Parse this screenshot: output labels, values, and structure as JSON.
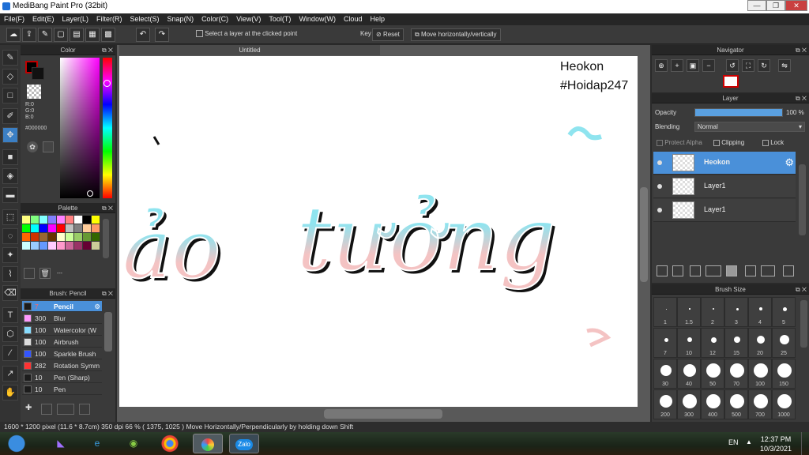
{
  "window": {
    "title": "MediBang Paint Pro (32bit)",
    "minimize": "—",
    "restore": "❐",
    "close": "✕"
  },
  "menu": [
    "File(F)",
    "Edit(E)",
    "Layer(L)",
    "Filter(R)",
    "Select(S)",
    "Snap(N)",
    "Color(C)",
    "View(V)",
    "Tool(T)",
    "Window(W)",
    "Cloud",
    "Help"
  ],
  "toolbar": {
    "select_layer_label": "Select a layer at the clicked point",
    "key_label": "Key",
    "reset_label": "Reset",
    "move_label": "Move horizontally/vertically"
  },
  "color_panel": {
    "title": "Color",
    "r": "R:0",
    "g": "G:0",
    "b": "B:0",
    "hex": "#000000",
    "fg": "#000000",
    "accent": "#c00000"
  },
  "palette_panel": {
    "title": "Palette",
    "colors": [
      "#ffff80",
      "#80ff80",
      "#80ffff",
      "#8080ff",
      "#ff80ff",
      "#ff8080",
      "#ffffff",
      "#000000",
      "#ffff00",
      "#00ff00",
      "#00ffff",
      "#0000ff",
      "#ff00ff",
      "#ff0000",
      "#c0c0c0",
      "#808080",
      "#ffcc99",
      "#ff9966",
      "#ff6600",
      "#cc3300",
      "#996633",
      "#663300",
      "#ffffcc",
      "#ccff99",
      "#99cc66",
      "#669933",
      "#336600",
      "#ccffff",
      "#99ccff",
      "#6699ff",
      "#ffccff",
      "#ff99cc",
      "#cc6699",
      "#993366",
      "#660033",
      "#cccc99"
    ],
    "dash": "---"
  },
  "brush_panel": {
    "title": "Brush: Pencil",
    "items": [
      {
        "size": "7",
        "name": "Pencil",
        "color": "#1c1c1c"
      },
      {
        "size": "300",
        "name": "Blur",
        "color": "#ff99ff"
      },
      {
        "size": "100",
        "name": "Watercolor (W",
        "color": "#88ddff"
      },
      {
        "size": "100",
        "name": "Airbrush",
        "color": "#dddddd"
      },
      {
        "size": "100",
        "name": "Sparkle Brush",
        "color": "#3355ff"
      },
      {
        "size": "282",
        "name": "Rotation Symm",
        "color": "#ff3333"
      },
      {
        "size": "10",
        "name": "Pen (Sharp)",
        "color": "#1c1c1c"
      },
      {
        "size": "10",
        "name": "Pen",
        "color": "#1c1c1c"
      }
    ]
  },
  "canvas": {
    "tab": "Untitled",
    "watermark_line1": "Heokon",
    "watermark_line2": "#Hoidap247",
    "art_text_left": "ảo",
    "art_text_right": "tưởng"
  },
  "navigator": {
    "title": "Navigator"
  },
  "layer_panel": {
    "title": "Layer",
    "opacity_label": "Opacity",
    "opacity_value": "100 %",
    "opacity_fraction": 1.0,
    "blending_label": "Blending",
    "blending_value": "Normal",
    "protect_alpha": "Protect Alpha",
    "clipping": "Clipping",
    "lock": "Lock",
    "layers": [
      {
        "name": "Heokon",
        "selected": true
      },
      {
        "name": "Layer1",
        "selected": false
      },
      {
        "name": "Layer1",
        "selected": false
      }
    ]
  },
  "brush_size_panel": {
    "title": "Brush Size",
    "sizes": [
      "1",
      "1.5",
      "2",
      "3",
      "4",
      "5",
      "7",
      "10",
      "12",
      "15",
      "20",
      "25",
      "30",
      "40",
      "50",
      "70",
      "100",
      "150",
      "200",
      "300",
      "400",
      "500",
      "700",
      "1000"
    ]
  },
  "status": "1600 * 1200 pixel   (11.6 * 8.7cm)   350 dpi   66 %   ( 1375, 1025 )   Move Horizontally/Perpendicularly by holding down Shift",
  "taskbar": {
    "lang": "EN",
    "time": "12:37 PM",
    "date": "10/3/2021",
    "zalo": "Zalo"
  }
}
